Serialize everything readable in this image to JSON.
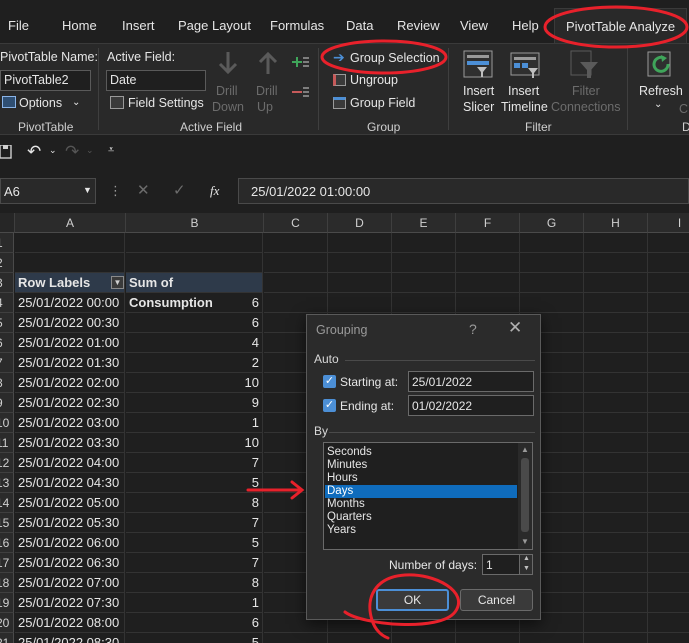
{
  "tabs": [
    "File",
    "Home",
    "Insert",
    "Page Layout",
    "Formulas",
    "Data",
    "Review",
    "View",
    "Help",
    "PivotTable Analyze"
  ],
  "ribbon": {
    "pivottable_name_label": "PivotTable Name:",
    "pivottable_name_value": "PivotTable2",
    "options_label": "Options",
    "group_pivottable": "PivotTable",
    "active_field_label": "Active Field:",
    "active_field_value": "Date",
    "field_settings_label": "Field Settings",
    "drill_down_1": "Drill",
    "drill_down_2": "Down",
    "drill_up_1": "Drill",
    "drill_up_2": "Up",
    "group_active_field": "Active Field",
    "group_selection_label": "Group Selection",
    "ungroup_label": "Ungroup",
    "group_field_label": "Group Field",
    "group_group": "Group",
    "insert_slicer_1": "Insert",
    "insert_slicer_2": "Slicer",
    "insert_timeline_1": "Insert",
    "insert_timeline_2": "Timeline",
    "filter_connections_1": "Filter",
    "filter_connections_2": "Connections",
    "group_filter": "Filter",
    "refresh_label": "Refresh",
    "partial_label": "D"
  },
  "formula_bar": {
    "name_box": "A6",
    "fx": "fx",
    "formula": "25/01/2022  01:00:00"
  },
  "columns": [
    "A",
    "B",
    "C",
    "D",
    "E",
    "F",
    "G",
    "H",
    "I"
  ],
  "row_numbers": [
    "1",
    "2",
    "3",
    "4",
    "5",
    "6",
    "7",
    "8",
    "9",
    "10",
    "11",
    "12",
    "13",
    "14",
    "15",
    "16",
    "17",
    "18",
    "19",
    "20",
    "21"
  ],
  "pivot": {
    "header_a": "Row Labels",
    "header_b": "Sum of Consumption",
    "rows": [
      {
        "label": "25/01/2022 00:00",
        "value": "6"
      },
      {
        "label": "25/01/2022 00:30",
        "value": "6"
      },
      {
        "label": "25/01/2022 01:00",
        "value": "4"
      },
      {
        "label": "25/01/2022 01:30",
        "value": "2"
      },
      {
        "label": "25/01/2022 02:00",
        "value": "10"
      },
      {
        "label": "25/01/2022 02:30",
        "value": "9"
      },
      {
        "label": "25/01/2022 03:00",
        "value": "1"
      },
      {
        "label": "25/01/2022 03:30",
        "value": "10"
      },
      {
        "label": "25/01/2022 04:00",
        "value": "7"
      },
      {
        "label": "25/01/2022 04:30",
        "value": "5"
      },
      {
        "label": "25/01/2022 05:00",
        "value": "8"
      },
      {
        "label": "25/01/2022 05:30",
        "value": "7"
      },
      {
        "label": "25/01/2022 06:00",
        "value": "5"
      },
      {
        "label": "25/01/2022 06:30",
        "value": "7"
      },
      {
        "label": "25/01/2022 07:00",
        "value": "8"
      },
      {
        "label": "25/01/2022 07:30",
        "value": "1"
      },
      {
        "label": "25/01/2022 08:00",
        "value": "6"
      },
      {
        "label": "25/01/2022 08:30",
        "value": "5"
      }
    ]
  },
  "dialog": {
    "title": "Grouping",
    "help": "?",
    "close": "✕",
    "auto_label": "Auto",
    "starting_at_label": "Starting at:",
    "starting_at_value": "25/01/2022",
    "ending_at_label": "Ending at:",
    "ending_at_value": "01/02/2022",
    "by_label": "By",
    "by_items": [
      "Seconds",
      "Minutes",
      "Hours",
      "Days",
      "Months",
      "Quarters",
      "Years"
    ],
    "selected_item": "Days",
    "number_of_days_label": "Number of days:",
    "number_of_days_value": "1",
    "ok_label": "OK",
    "cancel_label": "Cancel"
  },
  "colors": {
    "annotation_red": "#e8212b",
    "selection_blue": "#0f6cbd",
    "accent_blue": "#4c8fd6"
  }
}
